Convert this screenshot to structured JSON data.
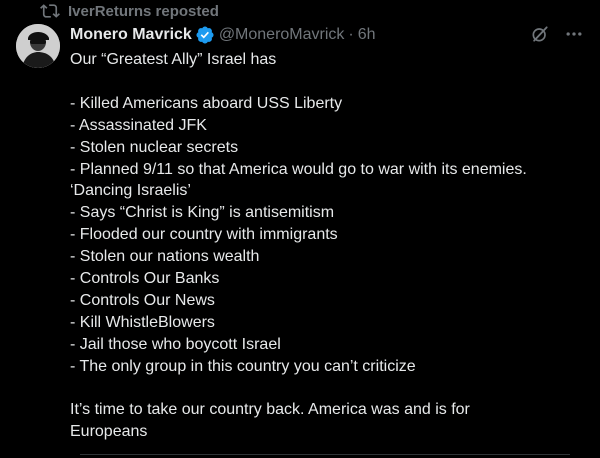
{
  "repost": {
    "icon": "repost-icon",
    "text": "IverReturns reposted"
  },
  "author": {
    "name": "Monero Mavrick",
    "handle": "@MoneroMavrick",
    "separator": "·",
    "time": "6h",
    "verified_icon": "verified-badge-icon",
    "verified_color": "#1d9bf0"
  },
  "actions": {
    "grok_icon": "grok-icon",
    "more_icon": "more-options-icon"
  },
  "post": {
    "intro": "Our “Greatest Ally” Israel has",
    "items": [
      "- Killed Americans aboard USS Liberty",
      "- Assassinated JFK",
      "- Stolen nuclear secrets",
      "- Planned 9/11 so that America would go to war with its enemies.",
      "‘Dancing Israelis’",
      "- Says “Christ is King” is antisemitism",
      "- Flooded our country with immigrants",
      "- Stolen our nations wealth",
      "- Controls Our Banks",
      "- Controls Our News",
      "- Kill WhistleBlowers",
      "- Jail those who boycott Israel",
      "- The only group in this country you can’t criticize"
    ],
    "closing_line1": "It’s time to take our country back. America was and is for",
    "closing_line2": "Europeans"
  },
  "colors": {
    "background": "#000000",
    "text": "#e7e9ea",
    "muted": "#71767b"
  }
}
